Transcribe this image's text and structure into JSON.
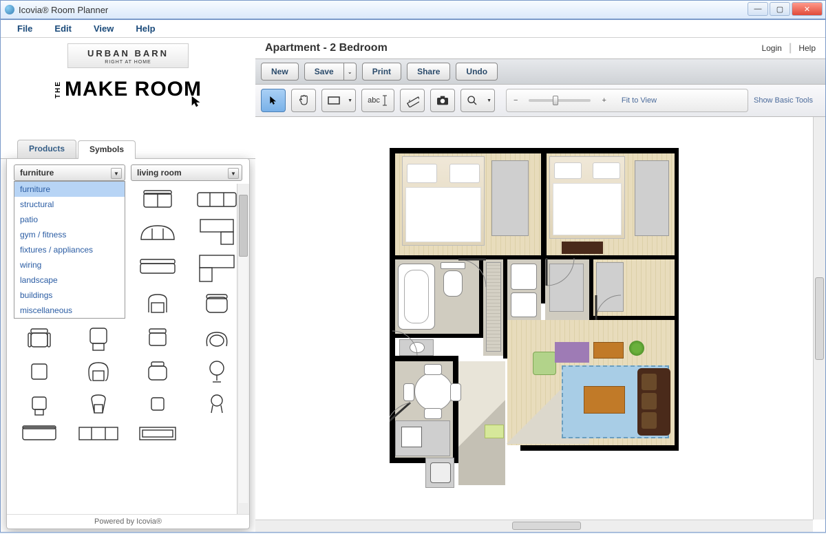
{
  "window": {
    "title": "Icovia® Room Planner"
  },
  "menu": [
    "File",
    "Edit",
    "View",
    "Help"
  ],
  "brand": {
    "urban_barn": "URBAN BARN",
    "urban_sub": "RIGHT AT HOME",
    "the": "THE",
    "make_room": "MAKE ROOM"
  },
  "tabs": [
    "Products",
    "Symbols"
  ],
  "active_tab": 1,
  "dd_category": {
    "value": "furniture",
    "options": [
      "furniture",
      "structural",
      "patio",
      "gym / fitness",
      "fixtures / appliances",
      "wiring",
      "landscape",
      "buildings",
      "miscellaneous"
    ]
  },
  "dd_room": {
    "value": "living room"
  },
  "footer": "Powered by Icovia®",
  "plan_title": "Apartment - 2 Bedroom",
  "header_links": [
    "Login",
    "Help"
  ],
  "toolbar1": {
    "new": "New",
    "save": "Save",
    "print": "Print",
    "share": "Share",
    "undo": "Undo"
  },
  "toolbar2": {
    "fit": "Fit to View",
    "basic": "Show Basic Tools",
    "text": "abc"
  }
}
